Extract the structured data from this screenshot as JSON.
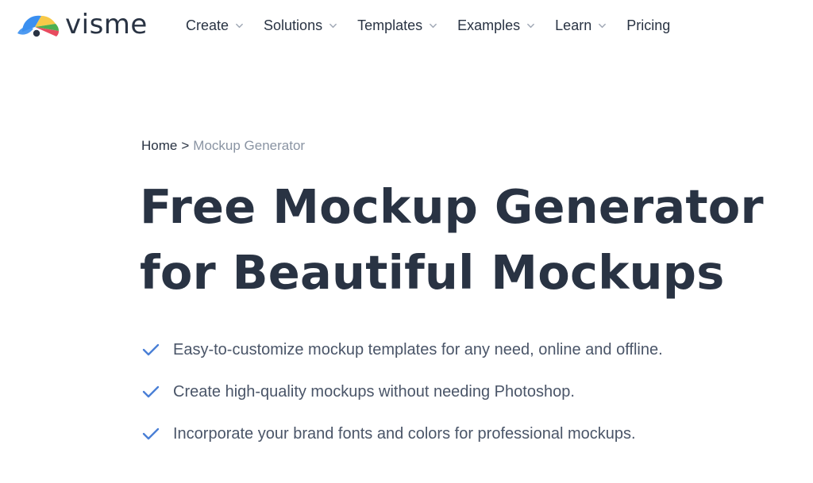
{
  "brand": {
    "name": "visme",
    "colors": {
      "text": "#293343",
      "muted": "#8a94a3",
      "check": "#4a7fd6",
      "logo_yellow": "#f7c948",
      "logo_green": "#4caf50",
      "logo_red": "#e84b5f",
      "logo_blue": "#3a8ff0"
    }
  },
  "nav": {
    "items": [
      {
        "label": "Create",
        "icon": "chevron-down-icon"
      },
      {
        "label": "Solutions",
        "icon": "chevron-down-icon"
      },
      {
        "label": "Templates",
        "icon": "chevron-down-icon"
      },
      {
        "label": "Examples",
        "icon": "chevron-down-icon"
      },
      {
        "label": "Learn",
        "icon": "chevron-down-icon"
      },
      {
        "label": "Pricing"
      }
    ]
  },
  "breadcrumb": {
    "home": "Home",
    "separator": ">",
    "current": "Mockup Generator"
  },
  "hero": {
    "title_line1": "Free Mockup Generator",
    "title_line2": "for Beautiful Mockups"
  },
  "features": [
    {
      "text": "Easy-to-customize mockup templates for any need, online and offline.",
      "icon": "check-icon"
    },
    {
      "text": "Create high-quality mockups without needing Photoshop.",
      "icon": "check-icon"
    },
    {
      "text": "Incorporate your brand fonts and colors for professional mockups.",
      "icon": "check-icon"
    }
  ]
}
